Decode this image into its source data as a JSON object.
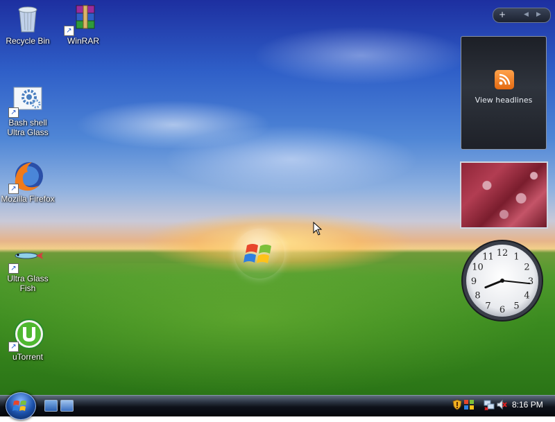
{
  "desktop": {
    "icons": [
      {
        "label": "Recycle Bin",
        "icon": "recycle-bin-icon"
      },
      {
        "label": "WinRAR",
        "icon": "winrar-icon"
      },
      {
        "label": "Bash shell Ultra Glass",
        "line1": "Bash shell",
        "line2": "Ultra Glass",
        "icon": "gear-document-icon"
      },
      {
        "label": "Mozilla Firefox",
        "icon": "firefox-icon"
      },
      {
        "label": "Ultra Glass Fish",
        "line1": "Ultra Glass",
        "line2": "Fish",
        "icon": "fish-icon"
      },
      {
        "label": "uTorrent",
        "icon": "utorrent-icon"
      }
    ]
  },
  "sidebar": {
    "controls": {
      "add": "+",
      "prev": "◀",
      "next": "▶"
    },
    "feeds_gadget": {
      "label": "View headlines",
      "icon": "rss-icon"
    },
    "slideshow_gadget": {
      "icon": "photo-icon"
    },
    "clock_gadget": {
      "numerals": [
        "12",
        "1",
        "2",
        "3",
        "4",
        "5",
        "6",
        "7",
        "8",
        "9",
        "10",
        "11"
      ],
      "hour": 8,
      "minute": 16
    }
  },
  "taskbar": {
    "start_icon": "windows-logo-icon",
    "quick_launch": [
      "show-desktop-icon",
      "switch-windows-icon"
    ],
    "tray": [
      "security-shield-icon",
      "network-icon",
      "volume-muted-icon"
    ],
    "time": "8:16 PM"
  },
  "colors": {
    "rss": "#f07d22",
    "taskbar": "#0d1119",
    "accent": "#1a4fa8"
  }
}
